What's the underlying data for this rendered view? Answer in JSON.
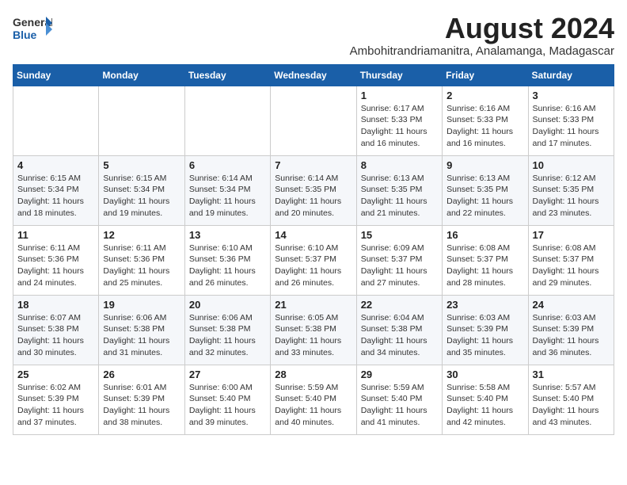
{
  "header": {
    "logo_general": "General",
    "logo_blue": "Blue",
    "main_title": "August 2024",
    "subtitle": "Ambohitrandriamanitra, Analamanga, Madagascar"
  },
  "calendar": {
    "days_of_week": [
      "Sunday",
      "Monday",
      "Tuesday",
      "Wednesday",
      "Thursday",
      "Friday",
      "Saturday"
    ],
    "weeks": [
      [
        {
          "day": "",
          "info": ""
        },
        {
          "day": "",
          "info": ""
        },
        {
          "day": "",
          "info": ""
        },
        {
          "day": "",
          "info": ""
        },
        {
          "day": "1",
          "info": "Sunrise: 6:17 AM\nSunset: 5:33 PM\nDaylight: 11 hours and 16 minutes."
        },
        {
          "day": "2",
          "info": "Sunrise: 6:16 AM\nSunset: 5:33 PM\nDaylight: 11 hours and 16 minutes."
        },
        {
          "day": "3",
          "info": "Sunrise: 6:16 AM\nSunset: 5:33 PM\nDaylight: 11 hours and 17 minutes."
        }
      ],
      [
        {
          "day": "4",
          "info": "Sunrise: 6:15 AM\nSunset: 5:34 PM\nDaylight: 11 hours and 18 minutes."
        },
        {
          "day": "5",
          "info": "Sunrise: 6:15 AM\nSunset: 5:34 PM\nDaylight: 11 hours and 19 minutes."
        },
        {
          "day": "6",
          "info": "Sunrise: 6:14 AM\nSunset: 5:34 PM\nDaylight: 11 hours and 19 minutes."
        },
        {
          "day": "7",
          "info": "Sunrise: 6:14 AM\nSunset: 5:35 PM\nDaylight: 11 hours and 20 minutes."
        },
        {
          "day": "8",
          "info": "Sunrise: 6:13 AM\nSunset: 5:35 PM\nDaylight: 11 hours and 21 minutes."
        },
        {
          "day": "9",
          "info": "Sunrise: 6:13 AM\nSunset: 5:35 PM\nDaylight: 11 hours and 22 minutes."
        },
        {
          "day": "10",
          "info": "Sunrise: 6:12 AM\nSunset: 5:35 PM\nDaylight: 11 hours and 23 minutes."
        }
      ],
      [
        {
          "day": "11",
          "info": "Sunrise: 6:11 AM\nSunset: 5:36 PM\nDaylight: 11 hours and 24 minutes."
        },
        {
          "day": "12",
          "info": "Sunrise: 6:11 AM\nSunset: 5:36 PM\nDaylight: 11 hours and 25 minutes."
        },
        {
          "day": "13",
          "info": "Sunrise: 6:10 AM\nSunset: 5:36 PM\nDaylight: 11 hours and 26 minutes."
        },
        {
          "day": "14",
          "info": "Sunrise: 6:10 AM\nSunset: 5:37 PM\nDaylight: 11 hours and 26 minutes."
        },
        {
          "day": "15",
          "info": "Sunrise: 6:09 AM\nSunset: 5:37 PM\nDaylight: 11 hours and 27 minutes."
        },
        {
          "day": "16",
          "info": "Sunrise: 6:08 AM\nSunset: 5:37 PM\nDaylight: 11 hours and 28 minutes."
        },
        {
          "day": "17",
          "info": "Sunrise: 6:08 AM\nSunset: 5:37 PM\nDaylight: 11 hours and 29 minutes."
        }
      ],
      [
        {
          "day": "18",
          "info": "Sunrise: 6:07 AM\nSunset: 5:38 PM\nDaylight: 11 hours and 30 minutes."
        },
        {
          "day": "19",
          "info": "Sunrise: 6:06 AM\nSunset: 5:38 PM\nDaylight: 11 hours and 31 minutes."
        },
        {
          "day": "20",
          "info": "Sunrise: 6:06 AM\nSunset: 5:38 PM\nDaylight: 11 hours and 32 minutes."
        },
        {
          "day": "21",
          "info": "Sunrise: 6:05 AM\nSunset: 5:38 PM\nDaylight: 11 hours and 33 minutes."
        },
        {
          "day": "22",
          "info": "Sunrise: 6:04 AM\nSunset: 5:38 PM\nDaylight: 11 hours and 34 minutes."
        },
        {
          "day": "23",
          "info": "Sunrise: 6:03 AM\nSunset: 5:39 PM\nDaylight: 11 hours and 35 minutes."
        },
        {
          "day": "24",
          "info": "Sunrise: 6:03 AM\nSunset: 5:39 PM\nDaylight: 11 hours and 36 minutes."
        }
      ],
      [
        {
          "day": "25",
          "info": "Sunrise: 6:02 AM\nSunset: 5:39 PM\nDaylight: 11 hours and 37 minutes."
        },
        {
          "day": "26",
          "info": "Sunrise: 6:01 AM\nSunset: 5:39 PM\nDaylight: 11 hours and 38 minutes."
        },
        {
          "day": "27",
          "info": "Sunrise: 6:00 AM\nSunset: 5:40 PM\nDaylight: 11 hours and 39 minutes."
        },
        {
          "day": "28",
          "info": "Sunrise: 5:59 AM\nSunset: 5:40 PM\nDaylight: 11 hours and 40 minutes."
        },
        {
          "day": "29",
          "info": "Sunrise: 5:59 AM\nSunset: 5:40 PM\nDaylight: 11 hours and 41 minutes."
        },
        {
          "day": "30",
          "info": "Sunrise: 5:58 AM\nSunset: 5:40 PM\nDaylight: 11 hours and 42 minutes."
        },
        {
          "day": "31",
          "info": "Sunrise: 5:57 AM\nSunset: 5:40 PM\nDaylight: 11 hours and 43 minutes."
        }
      ]
    ]
  }
}
